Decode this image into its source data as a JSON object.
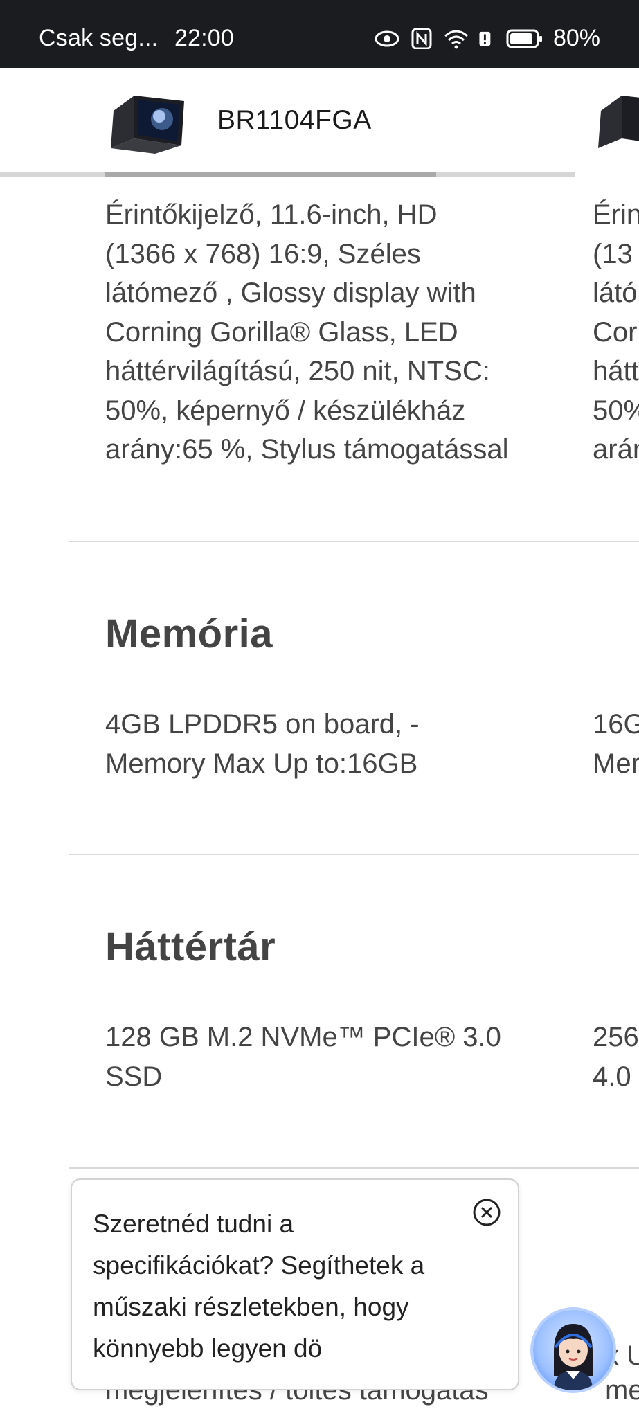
{
  "status_bar": {
    "carrier": "Csak seg...",
    "time": "22:00",
    "battery": "80%",
    "icons": [
      "eye-icon",
      "nfc-icon",
      "wifi-icon",
      "alert-icon",
      "battery-icon"
    ]
  },
  "product_header": {
    "product_name": "BR1104FGA",
    "scroll_progress": 0.58
  },
  "display_section": {
    "col1_lines": [
      "Érintőkijelző, 11.6-inch, HD",
      "(1366 x 768) 16:9, Széles",
      "látómező , Glossy display with",
      "Corning Gorilla® Glass, LED",
      "háttérvilágítású, 250 nit, NTSC:",
      "50%, képernyő / készülékház",
      "arány:65 %, Stylus támogatással"
    ],
    "col2_lines": [
      "Érin",
      "(13",
      "látó",
      "Cor",
      "hátt",
      "50%",
      "arán"
    ]
  },
  "memory_section": {
    "title": "Memória",
    "col1_lines": [
      "4GB LPDDR5 on board, -",
      "Memory Max Up to:16GB"
    ],
    "col2_lines": [
      "16G",
      "Mer"
    ]
  },
  "storage_section": {
    "title": "Háttértár",
    "col1_lines": [
      "128 GB M.2 NVMe™ PCIe® 3.0",
      "SSD"
    ],
    "col2_lines": [
      "256",
      "4.0"
    ]
  },
  "partial_section": {
    "col1_line": "megjelenítés / töltés támogatás",
    "col2_line_a": "x U",
    "col2_line_b": "me"
  },
  "chat_popup": {
    "message_lines": [
      "Szeretnéd tudni a",
      "specifikációkat? Segíthetek a",
      "műszaki részletekben, hogy",
      "könnyebb legyen dö"
    ]
  },
  "colors": {
    "status_bar_bg": "#1b1c1f",
    "assistant_accent": "#3b7cff"
  }
}
